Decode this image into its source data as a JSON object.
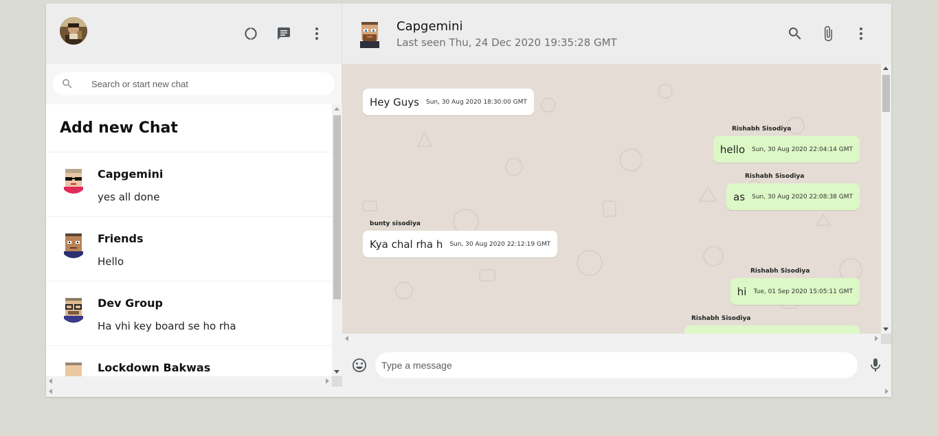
{
  "sidebar": {
    "search_placeholder": "Search or start new chat",
    "add_chat_label": "Add new Chat",
    "icons": [
      "status-icon",
      "new-chat-icon",
      "menu-icon"
    ],
    "chats": [
      {
        "name": "Capgemini",
        "last_message": "yes all done"
      },
      {
        "name": "Friends",
        "last_message": "Hello"
      },
      {
        "name": "Dev Group",
        "last_message": "Ha vhi key board se ho rha"
      },
      {
        "name": "Lockdown Bakwas",
        "last_message": ""
      }
    ]
  },
  "chat": {
    "title": "Capgemini",
    "status": "Last seen Thu, 24 Dec 2020 19:35:28 GMT",
    "icons": [
      "search-icon",
      "attach-icon",
      "menu-icon"
    ],
    "messages": [
      {
        "direction": "in",
        "sender": "",
        "text": "Hey Guys",
        "time": "Sun, 30 Aug 2020 18:30:00 GMT"
      },
      {
        "direction": "out",
        "sender": "Rishabh Sisodiya",
        "text": "hello",
        "time": "Sun, 30 Aug 2020 22:04:14 GMT"
      },
      {
        "direction": "out",
        "sender": "Rishabh Sisodiya",
        "text": "as",
        "time": "Sun, 30 Aug 2020 22:08:38 GMT"
      },
      {
        "direction": "in",
        "sender": "bunty sisodiya",
        "text": "Kya chal rha h",
        "time": "Sun, 30 Aug 2020 22:12:19 GMT"
      },
      {
        "direction": "out",
        "sender": "Rishabh Sisodiya",
        "text": "hi",
        "time": "Tue, 01 Sep 2020 15:05:11 GMT"
      },
      {
        "direction": "out",
        "sender": "Rishabh Sisodiya",
        "text": "",
        "time": ""
      }
    ],
    "composer_placeholder": "Type a message"
  },
  "colors": {
    "app_background": "#dadbd3",
    "header_background": "#ededed",
    "chat_background": "#e5ddd5",
    "incoming_bubble": "#ffffff",
    "outgoing_bubble": "#dcf8c6",
    "icon_color": "#51585c"
  }
}
